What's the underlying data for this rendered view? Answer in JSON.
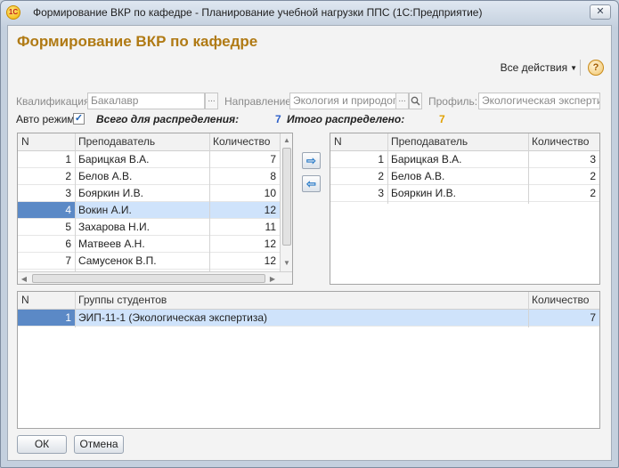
{
  "window": {
    "title": "Формирование ВКР по кафедре - Планирование учебной нагрузки ППС  (1С:Предприятие)",
    "app_icon_text": "1С",
    "close_glyph": "✕"
  },
  "form": {
    "title": "Формирование ВКР по кафедре",
    "all_actions_label": "Все действия",
    "help_glyph": "?"
  },
  "filters": {
    "qualification_label": "Квалификация:",
    "qualification_value": "Бакалавр",
    "direction_label": "Направление:",
    "direction_value": "Экология и природопо",
    "profile_label": "Профиль:",
    "profile_value": "Экологическая экспертиз",
    "select_glyph": "..."
  },
  "auto_mode": {
    "label": "Авто режим:",
    "checked_glyph": "✓"
  },
  "totals": {
    "to_distribute_label": "Всего для распределения:",
    "to_distribute_value": "7",
    "distributed_label": "Итого распределено:",
    "distributed_value": "7"
  },
  "left_table": {
    "columns": [
      "N",
      "Преподаватель",
      "Количество"
    ],
    "rows": [
      {
        "n": "1",
        "teacher": "Барицкая В.А.",
        "count": "7"
      },
      {
        "n": "2",
        "teacher": "Белов А.В.",
        "count": "8"
      },
      {
        "n": "3",
        "teacher": "Бояркин И.В.",
        "count": "10"
      },
      {
        "n": "4",
        "teacher": "Вокин А.И.",
        "count": "12"
      },
      {
        "n": "5",
        "teacher": "Захарова Н.И.",
        "count": "11"
      },
      {
        "n": "6",
        "teacher": "Матвеев А.Н.",
        "count": "12"
      },
      {
        "n": "7",
        "teacher": "Самусенок В.П.",
        "count": "12"
      }
    ]
  },
  "right_table": {
    "columns": [
      "N",
      "Преподаватель",
      "Количество"
    ],
    "rows": [
      {
        "n": "1",
        "teacher": "Барицкая В.А.",
        "count": "3"
      },
      {
        "n": "2",
        "teacher": "Белов А.В.",
        "count": "2"
      },
      {
        "n": "3",
        "teacher": "Бояркин И.В.",
        "count": "2"
      }
    ]
  },
  "groups_table": {
    "columns": [
      "N",
      "Группы студентов",
      "Количество"
    ],
    "rows": [
      {
        "n": "1",
        "group": "ЭИП-11-1 (Экологическая экспертиза)",
        "count": "7"
      }
    ]
  },
  "move": {
    "right_glyph": "⇨",
    "left_glyph": "⇦"
  },
  "buttons": {
    "ok": "ОК",
    "cancel": "Отмена"
  },
  "colors": {
    "title": "#b07a14",
    "selected_row": "#cfe3fb",
    "selected_num": "#5b89c6",
    "blue_value": "#2d5fc8",
    "orange_value": "#e0a000"
  }
}
